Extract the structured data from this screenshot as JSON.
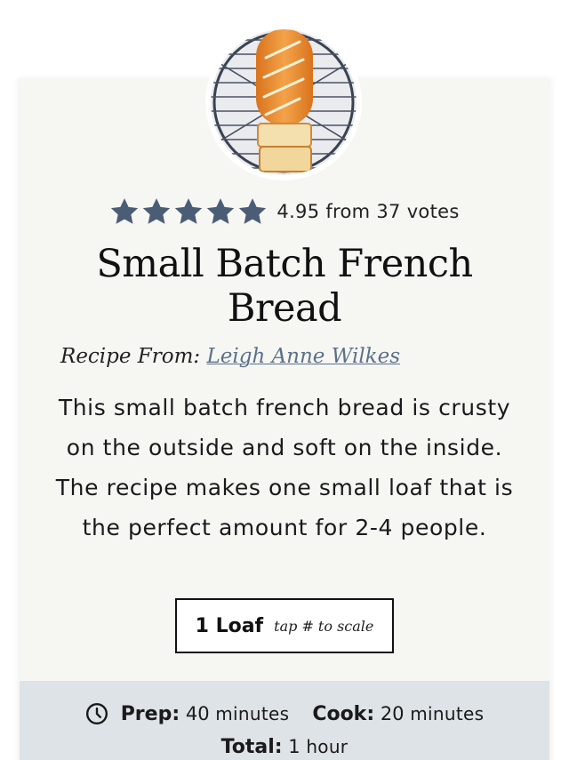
{
  "recipe": {
    "rating": {
      "stars": 5,
      "text": "4.95 from 37 votes"
    },
    "title": "Small Batch French Bread",
    "author_prefix": "Recipe From:",
    "author_name": "Leigh Anne Wilkes",
    "summary": "This small batch french bread is crusty on the outside and soft on the inside. The recipe makes one small loaf that is the perfect amount for 2-4 people.",
    "servings": {
      "value": "1 Loaf",
      "hint": "tap # to scale"
    },
    "times": {
      "prep_label": "Prep:",
      "prep_value": "40",
      "prep_unit": "minutes",
      "cook_label": "Cook:",
      "cook_value": "20",
      "cook_unit": "minutes",
      "total_label": "Total:",
      "total_value": "1",
      "total_unit": "hour"
    }
  },
  "colors": {
    "star": "#4b5d76",
    "link": "#5b7189",
    "card_bg": "#f6f6f3",
    "times_bg": "#dde3e7"
  },
  "icons": {
    "rating": "star-icon",
    "times": "clock-icon"
  }
}
